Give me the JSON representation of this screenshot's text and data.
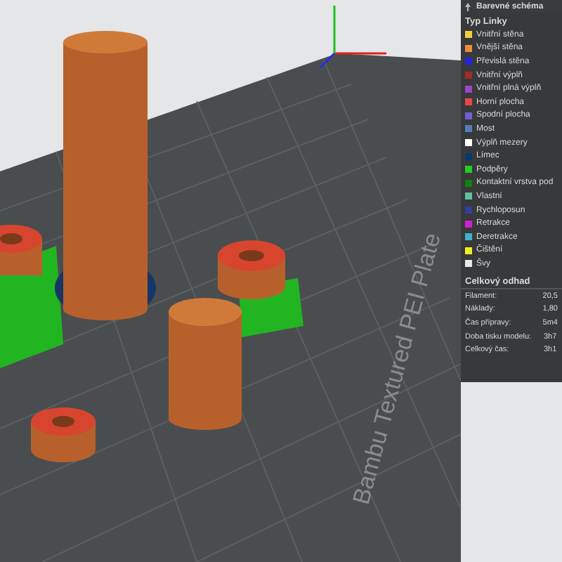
{
  "viewport": {
    "plate_label": "Bambu Textured PEI Plate"
  },
  "legend": {
    "header": "Barevné schéma",
    "section_title": "Typ Linky",
    "items": [
      {
        "label": "Vnitřní stěna",
        "color": "#f2d03a"
      },
      {
        "label": "Vnější stěna",
        "color": "#f08a3c"
      },
      {
        "label": "Převislá stěna",
        "color": "#2424d8"
      },
      {
        "label": "Vnitřní výplň",
        "color": "#a02c2c"
      },
      {
        "label": "Vnitřní plná výplň",
        "color": "#9848c8"
      },
      {
        "label": "Horní plocha",
        "color": "#e84848"
      },
      {
        "label": "Spodní plocha",
        "color": "#7060d0"
      },
      {
        "label": "Most",
        "color": "#5080b8"
      },
      {
        "label": "Výplň mezery",
        "color": "#ffffff"
      },
      {
        "label": "Límec",
        "color": "#0a3a6a"
      },
      {
        "label": "Podpěry",
        "color": "#20d020"
      },
      {
        "label": "Kontaktní vrstva pod",
        "color": "#108010"
      },
      {
        "label": "Vlastní",
        "color": "#60c0a0"
      },
      {
        "label": "Rychloposun",
        "color": "#3040a0"
      },
      {
        "label": "Retrakce",
        "color": "#d020d0"
      },
      {
        "label": "Deretrakce",
        "color": "#40b0d0"
      },
      {
        "label": "Čištění",
        "color": "#f0f020"
      },
      {
        "label": "Švy",
        "color": "#e8e8e8"
      }
    ],
    "estimate": {
      "title": "Celkový odhad",
      "rows": [
        {
          "label": "Filament:",
          "value": "20,5"
        },
        {
          "label": "Náklady:",
          "value": "1,80"
        },
        {
          "label": "Čas přípravy:",
          "value": "5m4"
        },
        {
          "label": "Doba tisku modelu:",
          "value": "3h7"
        },
        {
          "label": "Celkový čas:",
          "value": "3h1"
        }
      ]
    }
  }
}
